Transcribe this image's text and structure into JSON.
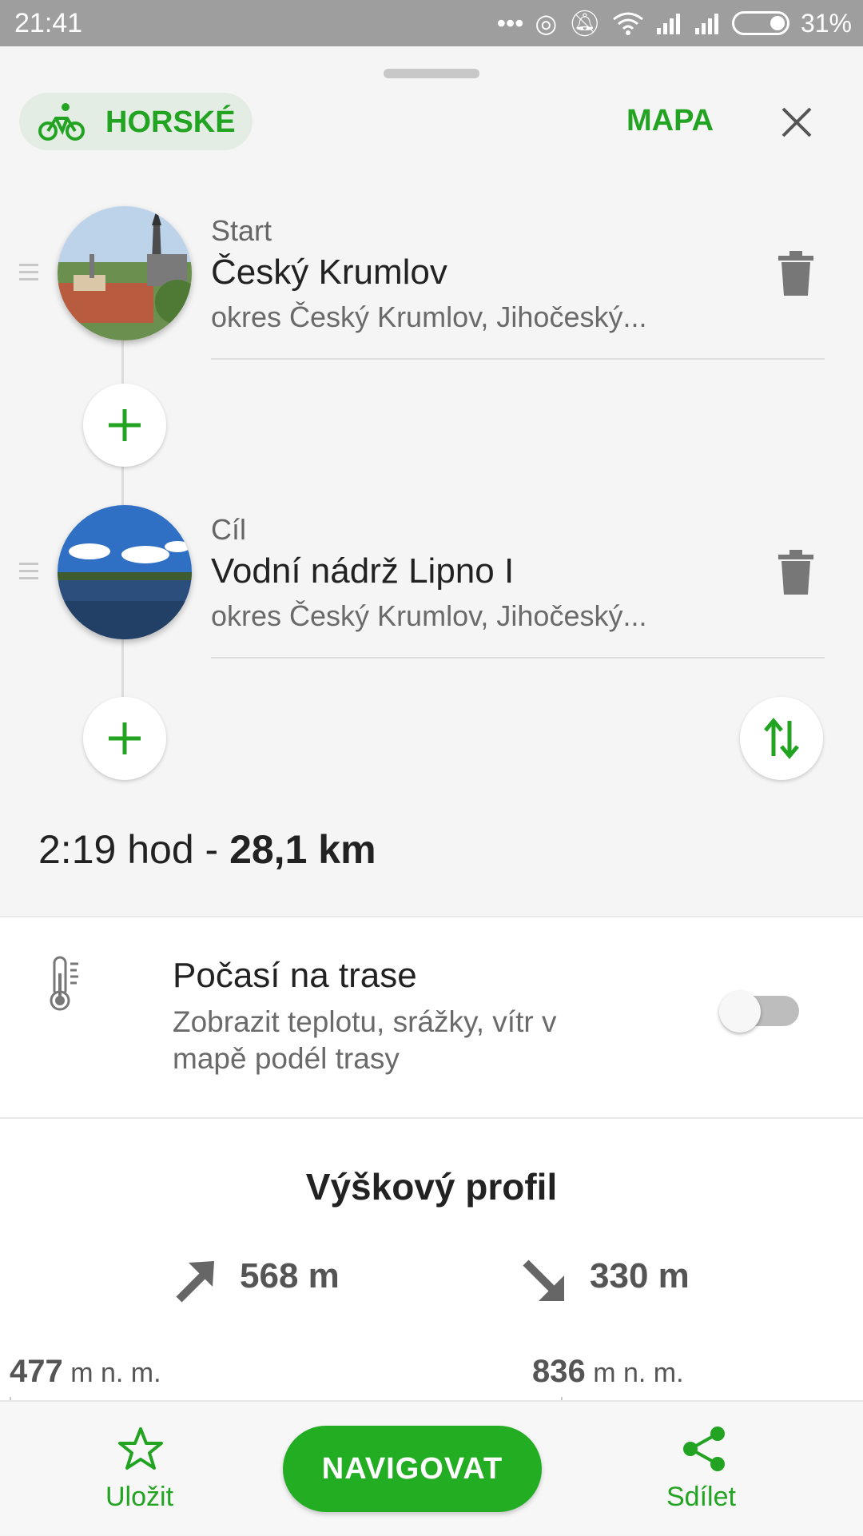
{
  "status_bar": {
    "time": "21:41",
    "battery": "31%"
  },
  "header": {
    "mode_label": "HORSKÉ",
    "map_label": "MAPA"
  },
  "waypoints": [
    {
      "tag": "Start",
      "name": "Český Krumlov",
      "subtitle": "okres Český Krumlov, Jihočeský..."
    },
    {
      "tag": "Cíl",
      "name": "Vodní nádrž Lipno I",
      "subtitle": "okres Český Krumlov, Jihočeský..."
    }
  ],
  "summary": {
    "duration": "2:19 hod - ",
    "distance": "28,1 km"
  },
  "weather": {
    "title": "Počasí na trase",
    "description": "Zobrazit teplotu, srážky, vítr v mapě podél trasy",
    "enabled": false
  },
  "elevation": {
    "title": "Výškový profil",
    "ascent": "568 m",
    "descent": "330 m",
    "min_alt_value": "477",
    "max_alt_value": "836",
    "alt_unit": " m n. m."
  },
  "bottom_bar": {
    "save_label": "Uložit",
    "navigate_label": "NAVIGOVAT",
    "share_label": "Sdílet"
  },
  "colors": {
    "accent": "#22a322",
    "button": "#23ad23"
  },
  "icons": [
    "bicycle-icon",
    "close-icon",
    "drag-handle-icon",
    "trash-icon",
    "plus-icon",
    "swap-icon",
    "thermometer-icon",
    "arrow-up-right-icon",
    "arrow-down-right-icon",
    "star-icon",
    "share-icon"
  ]
}
